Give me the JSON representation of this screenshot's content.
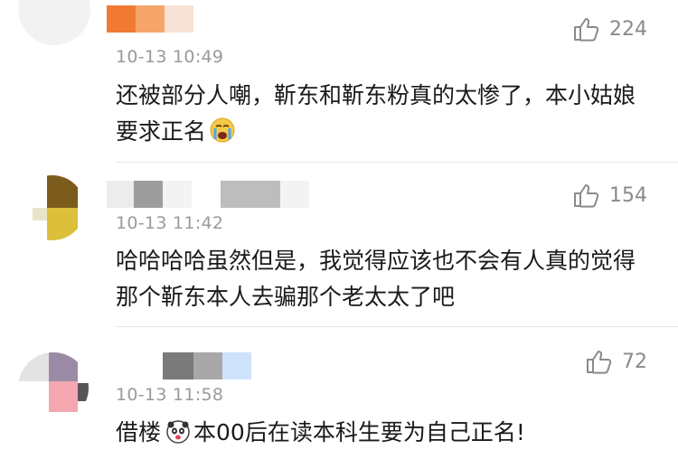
{
  "comments": [
    {
      "time": "10-13 10:49",
      "likes": "224",
      "text": "还被部分人嘲，靳东和靳东粉真的太惨了，本小姑娘要求正名",
      "trailing_emoji": "crying-face-emoji"
    },
    {
      "time": "10-13 11:42",
      "likes": "154",
      "text": "哈哈哈哈虽然但是，我觉得应该也不会有人真的觉得那个靳东本人去骗那个老太太了吧"
    },
    {
      "time": "10-13 11:58",
      "likes": "72",
      "text_before": "借楼",
      "inline_emoji": "panda-face-emoji",
      "text_after": "本00后在读本科生要为自己正名!"
    }
  ],
  "icons": {
    "like": "thumbs-up-icon"
  },
  "colors": {
    "text": "#1a1a1a",
    "meta": "#9a9a9a",
    "divider": "#e6e6e6"
  }
}
